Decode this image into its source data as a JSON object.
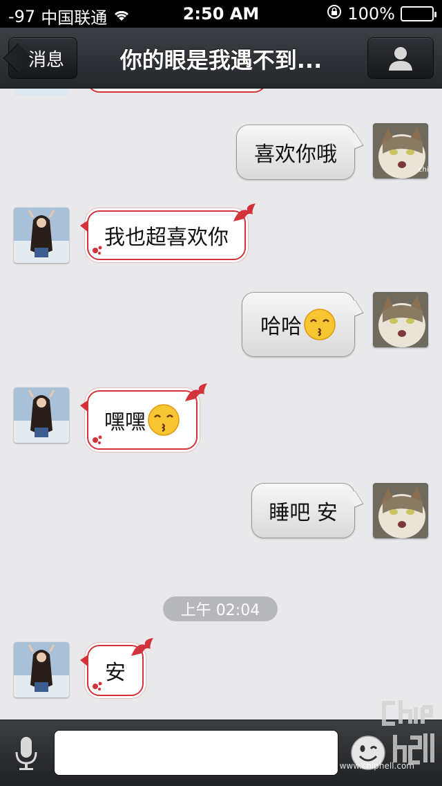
{
  "status_bar": {
    "signal": "-97",
    "carrier": "中国联通",
    "time": "2:50 AM",
    "battery": "100%"
  },
  "nav": {
    "back_label": "消息",
    "title": "你的眼是我遇不到..."
  },
  "messages": [
    {
      "from": "me",
      "text": "喜欢你哦",
      "emoji": ""
    },
    {
      "from": "them",
      "text": "我也超喜欢你",
      "emoji": ""
    },
    {
      "from": "me",
      "text": "哈哈",
      "emoji": "kissing-face"
    },
    {
      "from": "them",
      "text": "嘿嘿",
      "emoji": "kissing-face"
    },
    {
      "from": "me",
      "text": "睡吧 安",
      "emoji": ""
    },
    {
      "from": "them",
      "text": "安",
      "emoji": ""
    }
  ],
  "timestamp": "上午 02:04",
  "input": {
    "value": "",
    "placeholder": ""
  },
  "watermark": {
    "logo_text": "chip hell",
    "url": "www.chiphell.com"
  },
  "colors": {
    "accent_red": "#d2323a",
    "nav_bg": "#2b2e32",
    "chat_bg": "#e9e9ec"
  }
}
